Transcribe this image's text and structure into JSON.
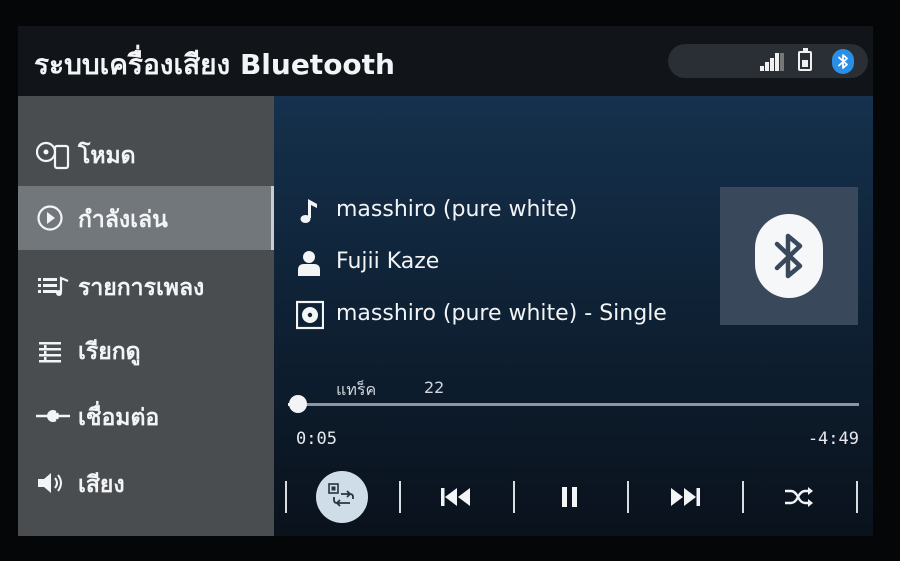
{
  "header": {
    "title": "ระบบเครื่องเสียง Bluetooth"
  },
  "status": {
    "signal_icon": "signal-bars-icon",
    "battery_icon": "battery-icon",
    "bluetooth_icon": "bluetooth-icon",
    "bluetooth_color": "#2b8fe8"
  },
  "sidebar": {
    "items": [
      {
        "label": "โหมด",
        "icon": "disc-phone-icon",
        "active": false
      },
      {
        "label": "กำลังเล่น",
        "icon": "play-circle-icon",
        "active": true
      },
      {
        "label": "รายการเพลง",
        "icon": "playlist-icon",
        "active": false
      },
      {
        "label": "เรียกดู",
        "icon": "browse-list-icon",
        "active": false
      },
      {
        "label": "เชื่อมต่อ",
        "icon": "connect-icon",
        "active": false
      },
      {
        "label": "เสียง",
        "icon": "speaker-icon",
        "active": false
      }
    ]
  },
  "now_playing": {
    "song": "masshiro (pure white)",
    "artist": "Fujii Kaze",
    "album": "masshiro (pure white) - Single",
    "track_label": "แทร็ค",
    "track_number": "22",
    "elapsed": "0:05",
    "remaining": "-4:49",
    "progress_fraction": 0.017,
    "album_art_icon": "bluetooth-icon"
  },
  "controls": [
    {
      "name": "repeat-button",
      "icon": "repeat-icon"
    },
    {
      "name": "previous-button",
      "icon": "skip-previous-icon"
    },
    {
      "name": "pause-button",
      "icon": "pause-icon"
    },
    {
      "name": "next-button",
      "icon": "skip-next-icon"
    },
    {
      "name": "shuffle-button",
      "icon": "shuffle-icon"
    }
  ],
  "colors": {
    "sidebar_bg": "#4a4d4f",
    "sidebar_active": "#72777c",
    "main_bg_top": "#15314d",
    "repeat_active": "#cfdde9"
  }
}
